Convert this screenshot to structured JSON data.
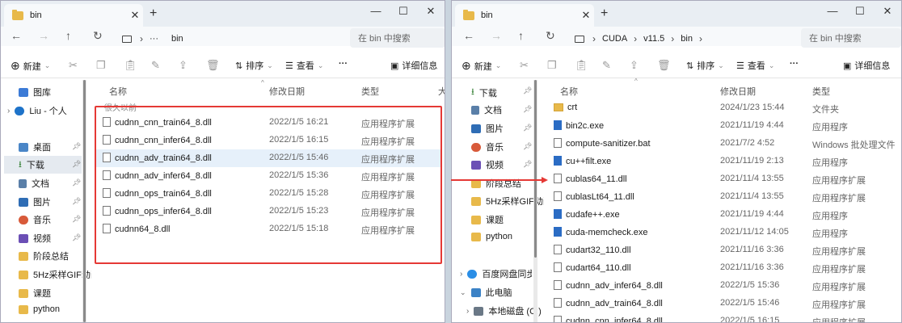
{
  "windowA": {
    "tab_title": "bin",
    "address": [
      "bin"
    ],
    "search_placeholder": "在 bin 中搜索",
    "toolbar": {
      "new_label": "新建",
      "sort_label": "排序",
      "view_label": "查看",
      "more_label": "···",
      "details_label": "详细信息"
    },
    "columns": {
      "name": "名称",
      "date": "修改日期",
      "type": "类型",
      "extra": "大"
    },
    "group_label": "很久以前",
    "sidebar": [
      {
        "label": "图库"
      },
      {
        "label": "Liu - 个人"
      },
      {
        "label": "桌面"
      },
      {
        "label": "下载"
      },
      {
        "label": "文档"
      },
      {
        "label": "图片"
      },
      {
        "label": "音乐"
      },
      {
        "label": "视频"
      },
      {
        "label": "阶段总结"
      },
      {
        "label": "5Hz采样GIF动画"
      },
      {
        "label": "课题"
      },
      {
        "label": "python"
      }
    ],
    "files": [
      {
        "name": "cudnn_cnn_train64_8.dll",
        "date": "2022/1/5 16:21",
        "type": "应用程序扩展"
      },
      {
        "name": "cudnn_cnn_infer64_8.dll",
        "date": "2022/1/5 16:15",
        "type": "应用程序扩展"
      },
      {
        "name": "cudnn_adv_train64_8.dll",
        "date": "2022/1/5 15:46",
        "type": "应用程序扩展"
      },
      {
        "name": "cudnn_adv_infer64_8.dll",
        "date": "2022/1/5 15:36",
        "type": "应用程序扩展"
      },
      {
        "name": "cudnn_ops_train64_8.dll",
        "date": "2022/1/5 15:28",
        "type": "应用程序扩展"
      },
      {
        "name": "cudnn_ops_infer64_8.dll",
        "date": "2022/1/5 15:23",
        "type": "应用程序扩展"
      },
      {
        "name": "cudnn64_8.dll",
        "date": "2022/1/5 15:18",
        "type": "应用程序扩展"
      }
    ]
  },
  "windowB": {
    "tab_title": "bin",
    "address": [
      "CUDA",
      "v11.5",
      "bin"
    ],
    "search_placeholder": "在 bin 中搜索",
    "toolbar": {
      "new_label": "新建",
      "sort_label": "排序",
      "view_label": "查看",
      "more_label": "···",
      "details_label": "详细信息"
    },
    "columns": {
      "name": "名称",
      "date": "修改日期",
      "type": "类型"
    },
    "sidebar": [
      {
        "label": "下载"
      },
      {
        "label": "文档"
      },
      {
        "label": "图片"
      },
      {
        "label": "音乐"
      },
      {
        "label": "视频"
      },
      {
        "label": "阶段总结"
      },
      {
        "label": "5Hz采样GIF动画"
      },
      {
        "label": "课题"
      },
      {
        "label": "python"
      },
      {
        "label": "百度网盘同步空间"
      },
      {
        "label": "此电脑"
      },
      {
        "label": "本地磁盘 (C:)"
      }
    ],
    "files": [
      {
        "name": "crt",
        "date": "2024/1/23 15:44",
        "type": "文件夹",
        "kind": "folder"
      },
      {
        "name": "bin2c.exe",
        "date": "2021/11/19 4:44",
        "type": "应用程序",
        "kind": "exe"
      },
      {
        "name": "compute-sanitizer.bat",
        "date": "2021/7/2 4:52",
        "type": "Windows 批处理文件",
        "kind": "file"
      },
      {
        "name": "cu++filt.exe",
        "date": "2021/11/19 2:13",
        "type": "应用程序",
        "kind": "exe"
      },
      {
        "name": "cublas64_11.dll",
        "date": "2021/11/4 13:55",
        "type": "应用程序扩展",
        "kind": "file"
      },
      {
        "name": "cublasLt64_11.dll",
        "date": "2021/11/4 13:55",
        "type": "应用程序扩展",
        "kind": "file"
      },
      {
        "name": "cudafe++.exe",
        "date": "2021/11/19 4:44",
        "type": "应用程序",
        "kind": "exe"
      },
      {
        "name": "cuda-memcheck.exe",
        "date": "2021/11/12 14:05",
        "type": "应用程序",
        "kind": "exe"
      },
      {
        "name": "cudart32_110.dll",
        "date": "2021/11/16 3:36",
        "type": "应用程序扩展",
        "kind": "file"
      },
      {
        "name": "cudart64_110.dll",
        "date": "2021/11/16 3:36",
        "type": "应用程序扩展",
        "kind": "file"
      },
      {
        "name": "cudnn_adv_infer64_8.dll",
        "date": "2022/1/5 15:36",
        "type": "应用程序扩展",
        "kind": "file"
      },
      {
        "name": "cudnn_adv_train64_8.dll",
        "date": "2022/1/5 15:46",
        "type": "应用程序扩展",
        "kind": "file"
      },
      {
        "name": "cudnn_cnn_infer64_8.dll",
        "date": "2022/1/5 16:15",
        "type": "应用程序扩展",
        "kind": "file"
      }
    ]
  },
  "colors": {
    "highlight_box": "#e53935",
    "arrow": "#e53935",
    "folder": "#e8b94a",
    "selected_row": "#cce4f7"
  }
}
